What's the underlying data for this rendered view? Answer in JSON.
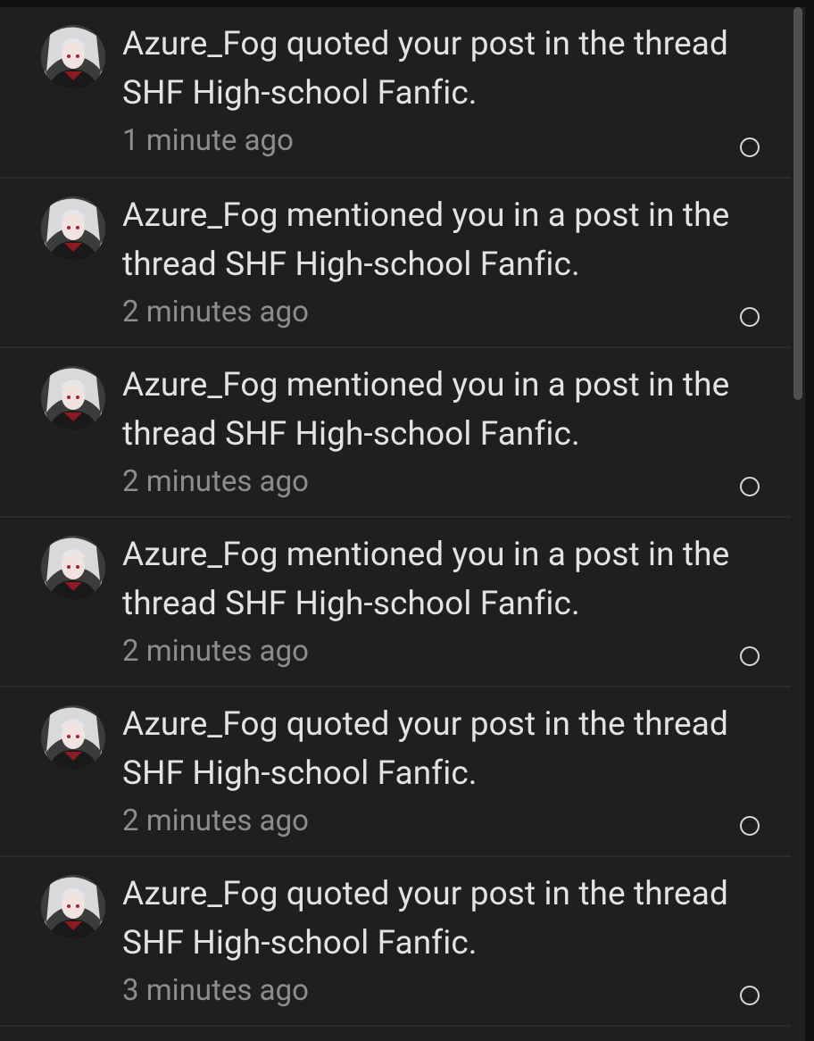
{
  "notifications": [
    {
      "user": "Azure_Fog",
      "message": "Azure_Fog quoted your post in the thread SHF High-school Fanfic.",
      "time": "1 minute ago",
      "unread": true
    },
    {
      "user": "Azure_Fog",
      "message": "Azure_Fog mentioned you in a post in the thread SHF High-school Fanfic.",
      "time": "2 minutes ago",
      "unread": true
    },
    {
      "user": "Azure_Fog",
      "message": "Azure_Fog mentioned you in a post in the thread SHF High-school Fanfic.",
      "time": "2 minutes ago",
      "unread": true
    },
    {
      "user": "Azure_Fog",
      "message": "Azure_Fog mentioned you in a post in the thread SHF High-school Fanfic.",
      "time": "2 minutes ago",
      "unread": true
    },
    {
      "user": "Azure_Fog",
      "message": "Azure_Fog quoted your post in the thread SHF High-school Fanfic.",
      "time": "2 minutes ago",
      "unread": true
    },
    {
      "user": "Azure_Fog",
      "message": "Azure_Fog quoted your post in the thread SHF High-school Fanfic.",
      "time": "3 minutes ago",
      "unread": true
    }
  ],
  "icons": {
    "avatar": "user-avatar-icon",
    "mark_read": "circle-outline-icon"
  },
  "colors": {
    "panel_background": "#1f1f1f",
    "message_text": "#e3e3e3",
    "time_text": "#8d8d8d",
    "divider": "#2c2c2c",
    "scrollbar_thumb": "#505050"
  }
}
